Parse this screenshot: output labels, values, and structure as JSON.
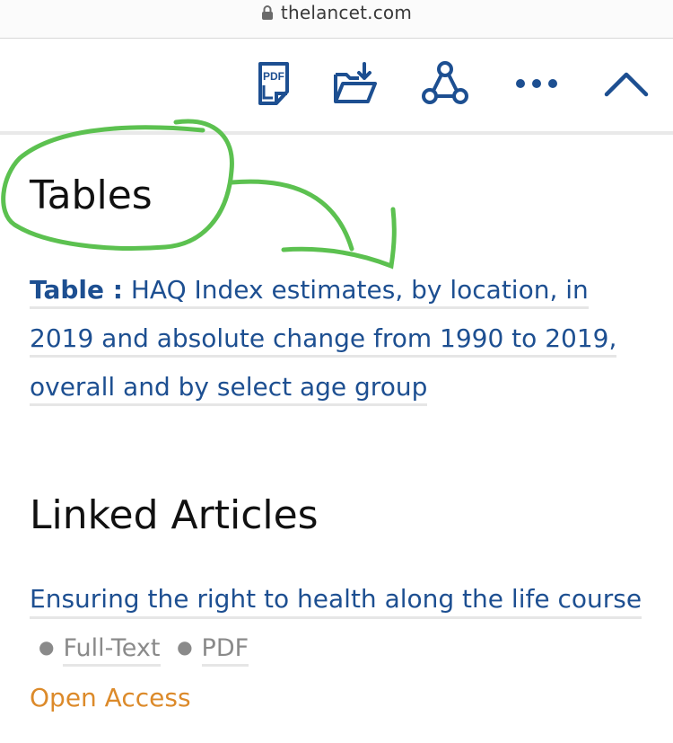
{
  "browser": {
    "url": "thelancet.com"
  },
  "toolbar": {
    "pdf_icon_text": "PDF",
    "colors": {
      "icon": "#1d4f91",
      "annotation": "#5cc150"
    }
  },
  "tables": {
    "heading": "Tables",
    "table_label": "Table :",
    "table_title": "HAQ Index estimates, by location, in 2019 and absolute change from 1990 to 2019, overall and by select age group"
  },
  "linked": {
    "heading": "Linked Articles",
    "article_title": "Ensuring the right to health along the life course",
    "full_text": "Full-Text",
    "pdf": "PDF",
    "access": "Open Access"
  }
}
